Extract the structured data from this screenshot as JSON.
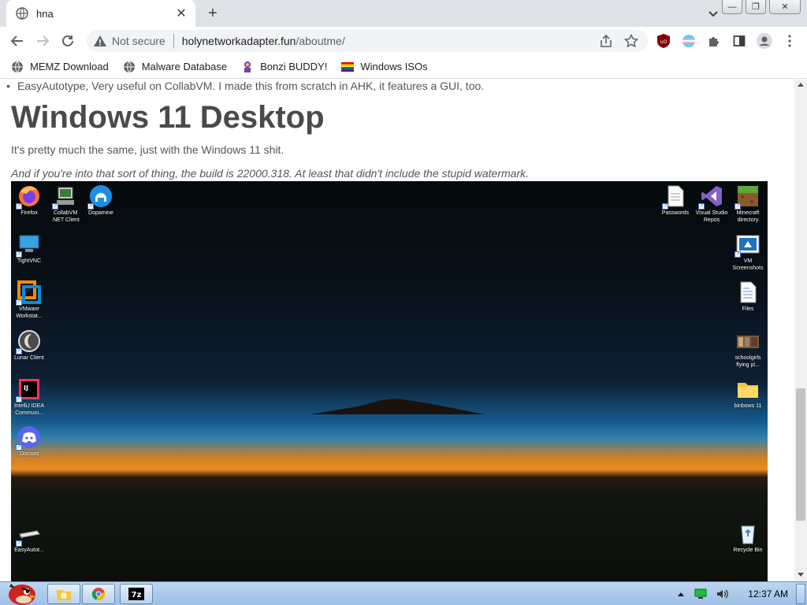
{
  "browser": {
    "tab_title": "hna",
    "new_tab_glyph": "+",
    "close_glyph": "✕",
    "security_label": "Not secure",
    "url_host": "holynetworkadapter.fun",
    "url_path": "/aboutme/",
    "window_buttons": {
      "minimize": "—",
      "maximize": "❐",
      "close": "✕"
    }
  },
  "bookmarks": [
    {
      "label": "MEMZ Download",
      "icon": "globe-icon"
    },
    {
      "label": "Malware Database",
      "icon": "globe-icon"
    },
    {
      "label": "Bonzi BUDDY!",
      "icon": "bonzi-icon"
    },
    {
      "label": "Windows ISOs",
      "icon": "rainbow-flag-icon"
    }
  ],
  "page": {
    "bullet_text": "EasyAutotype, Very useful on CollabVM. I made this from scratch in AHK, it features a GUI, too.",
    "heading": "Windows 11 Desktop",
    "paragraph1": "It's pretty much the same, just with the Windows 11 shit.",
    "paragraph2": "And if you're into that sort of thing, the build is 22000.318. At least that didn't include the stupid watermark."
  },
  "desktop_icons": {
    "left": [
      {
        "label": "Firefox",
        "icon": "firefox-icon"
      },
      {
        "label": "CollabVM .NET Client",
        "icon": "collabvm-icon"
      },
      {
        "label": "Dopamine",
        "icon": "dopamine-icon"
      },
      {
        "label": "TightVNC",
        "icon": "tightvnc-icon"
      },
      {
        "label": "VMware Workstat...",
        "icon": "vmware-icon"
      },
      {
        "label": "Lunar Client",
        "icon": "lunar-client-icon"
      },
      {
        "label": "IntelliJ IDEA Communi...",
        "icon": "intellij-icon"
      },
      {
        "label": "Discord",
        "icon": "discord-icon"
      },
      {
        "label": "EasyAutot...",
        "icon": "keyboard-icon"
      }
    ],
    "right": [
      {
        "label": "Passwords",
        "icon": "text-file-icon"
      },
      {
        "label": "Visual Studio Repos",
        "icon": "visual-studio-icon"
      },
      {
        "label": "Minecraft directory",
        "icon": "minecraft-icon"
      },
      {
        "label": "VM Screenshots",
        "icon": "screenshots-icon"
      },
      {
        "label": "Files",
        "icon": "document-icon"
      },
      {
        "label": "schoolgirls flying pl...",
        "icon": "image-file-icon"
      },
      {
        "label": "binbows 11",
        "icon": "folder-icon"
      },
      {
        "label": "Recycle Bin",
        "icon": "recycle-bin-icon"
      }
    ]
  },
  "taskbar": {
    "clock": "12:37 AM",
    "items": [
      "explorer-icon",
      "chrome-icon",
      "7zip-icon"
    ],
    "seven_zip_label": "7z"
  },
  "colors": {
    "tabbar_bg": "#dee1e6",
    "omnibox_bg": "#f1f3f4",
    "heading_color": "#4a4a4a",
    "taskbar_top": "#bcd6ef"
  }
}
